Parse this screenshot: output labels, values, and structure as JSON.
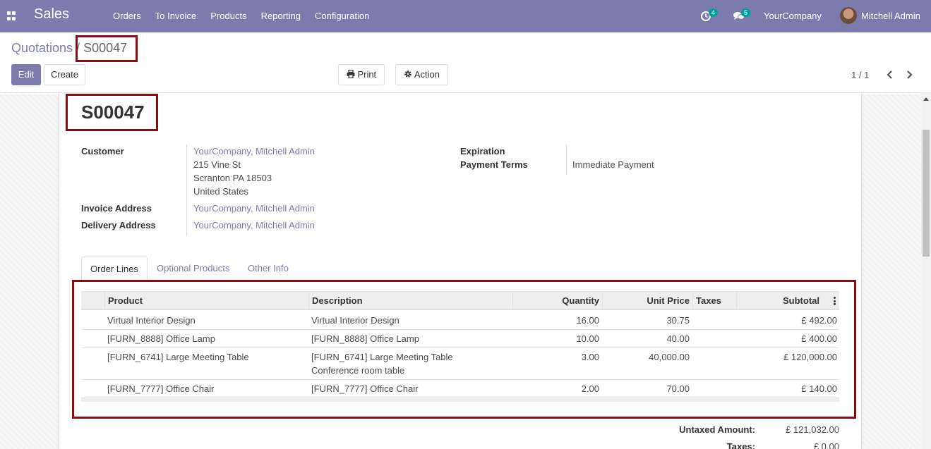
{
  "navbar": {
    "app_name": "Sales",
    "menu": [
      "Orders",
      "To Invoice",
      "Products",
      "Reporting",
      "Configuration"
    ],
    "activity_count": "4",
    "messages_count": "5",
    "company": "YourCompany",
    "user": "Mitchell Admin"
  },
  "breadcrumb": {
    "parent": "Quotations",
    "separator": "/",
    "current": "S00047"
  },
  "buttons": {
    "edit": "Edit",
    "create": "Create",
    "print": "Print",
    "action": "Action"
  },
  "pager": {
    "value": "1 / 1"
  },
  "document": {
    "name": "S00047",
    "customer_label": "Customer",
    "customer_name": "YourCompany, Mitchell Admin",
    "customer_address": [
      "215 Vine St",
      "Scranton PA 18503",
      "United States"
    ],
    "invoice_address_label": "Invoice Address",
    "invoice_address": "YourCompany, Mitchell Admin",
    "delivery_address_label": "Delivery Address",
    "delivery_address": "YourCompany, Mitchell Admin",
    "expiration_label": "Expiration",
    "expiration_value": "",
    "payment_terms_label": "Payment Terms",
    "payment_terms": "Immediate Payment"
  },
  "tabs": [
    "Order Lines",
    "Optional Products",
    "Other Info"
  ],
  "order_lines": {
    "columns": [
      "Product",
      "Description",
      "Quantity",
      "Unit Price",
      "Taxes",
      "Subtotal"
    ],
    "rows": [
      {
        "product": "Virtual Interior Design",
        "description": "Virtual Interior Design",
        "description2": "",
        "quantity": "16.00",
        "unit_price": "30.75",
        "taxes": "",
        "subtotal": "£ 492.00"
      },
      {
        "product": "[FURN_8888] Office Lamp",
        "description": "[FURN_8888] Office Lamp",
        "description2": "",
        "quantity": "10.00",
        "unit_price": "40.00",
        "taxes": "",
        "subtotal": "£ 400.00"
      },
      {
        "product": "[FURN_6741] Large Meeting Table",
        "description": "[FURN_6741] Large Meeting Table",
        "description2": "Conference room table",
        "quantity": "3.00",
        "unit_price": "40,000.00",
        "taxes": "",
        "subtotal": "£ 120,000.00"
      },
      {
        "product": "[FURN_7777] Office Chair",
        "description": "[FURN_7777] Office Chair",
        "description2": "",
        "quantity": "2.00",
        "unit_price": "70.00",
        "taxes": "",
        "subtotal": "£ 140.00"
      }
    ]
  },
  "totals": {
    "untaxed_label": "Untaxed Amount:",
    "untaxed_value": "£ 121,032.00",
    "taxes_label": "Taxes:",
    "taxes_value": "£ 0.00"
  },
  "colors": {
    "brand": "#7c7bad",
    "highlight": "#8b0b13",
    "badge": "#00a09d"
  },
  "icons": [
    "apps-icon",
    "activity-clock-icon",
    "messages-icon",
    "print-icon",
    "gear-icon",
    "chevron-left-icon",
    "chevron-right-icon",
    "kebab-icon"
  ]
}
